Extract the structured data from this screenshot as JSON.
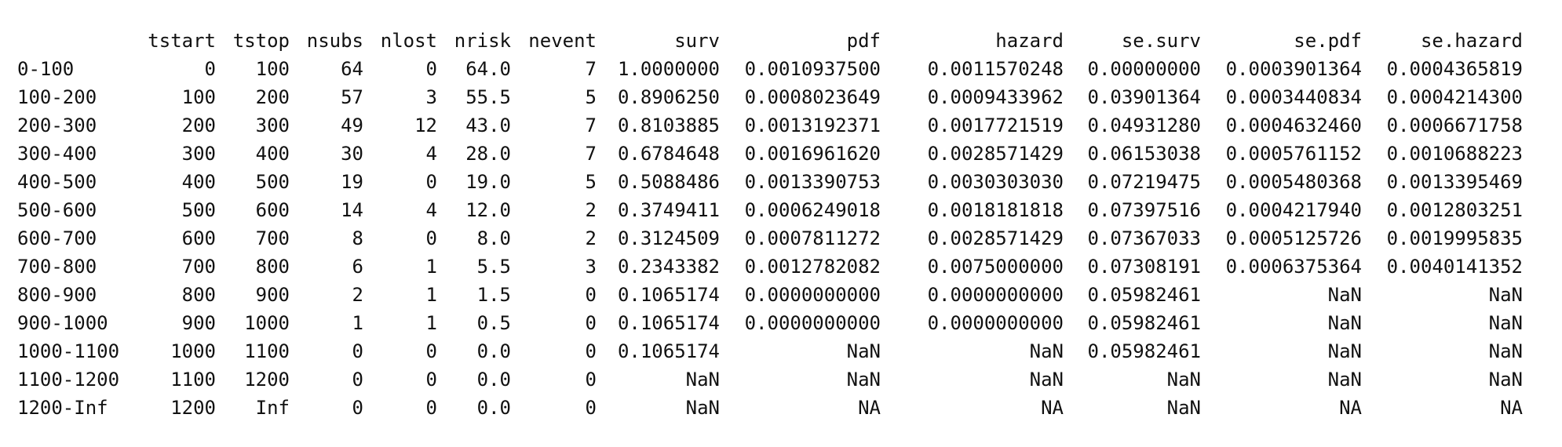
{
  "table": {
    "columns": [
      "",
      "tstart",
      "tstop",
      "nsubs",
      "nlost",
      "nrisk",
      "nevent",
      "surv",
      "pdf",
      "hazard",
      "se.surv",
      "se.pdf",
      "se.hazard"
    ],
    "rows": [
      [
        "0-100",
        "0",
        "100",
        "64",
        "0",
        "64.0",
        "7",
        "1.0000000",
        "0.0010937500",
        "0.0011570248",
        "0.00000000",
        "0.0003901364",
        "0.0004365819"
      ],
      [
        "100-200",
        "100",
        "200",
        "57",
        "3",
        "55.5",
        "5",
        "0.8906250",
        "0.0008023649",
        "0.0009433962",
        "0.03901364",
        "0.0003440834",
        "0.0004214300"
      ],
      [
        "200-300",
        "200",
        "300",
        "49",
        "12",
        "43.0",
        "7",
        "0.8103885",
        "0.0013192371",
        "0.0017721519",
        "0.04931280",
        "0.0004632460",
        "0.0006671758"
      ],
      [
        "300-400",
        "300",
        "400",
        "30",
        "4",
        "28.0",
        "7",
        "0.6784648",
        "0.0016961620",
        "0.0028571429",
        "0.06153038",
        "0.0005761152",
        "0.0010688223"
      ],
      [
        "400-500",
        "400",
        "500",
        "19",
        "0",
        "19.0",
        "5",
        "0.5088486",
        "0.0013390753",
        "0.0030303030",
        "0.07219475",
        "0.0005480368",
        "0.0013395469"
      ],
      [
        "500-600",
        "500",
        "600",
        "14",
        "4",
        "12.0",
        "2",
        "0.3749411",
        "0.0006249018",
        "0.0018181818",
        "0.07397516",
        "0.0004217940",
        "0.0012803251"
      ],
      [
        "600-700",
        "600",
        "700",
        "8",
        "0",
        "8.0",
        "2",
        "0.3124509",
        "0.0007811272",
        "0.0028571429",
        "0.07367033",
        "0.0005125726",
        "0.0019995835"
      ],
      [
        "700-800",
        "700",
        "800",
        "6",
        "1",
        "5.5",
        "3",
        "0.2343382",
        "0.0012782082",
        "0.0075000000",
        "0.07308191",
        "0.0006375364",
        "0.0040141352"
      ],
      [
        "800-900",
        "800",
        "900",
        "2",
        "1",
        "1.5",
        "0",
        "0.1065174",
        "0.0000000000",
        "0.0000000000",
        "0.05982461",
        "NaN",
        "NaN"
      ],
      [
        "900-1000",
        "900",
        "1000",
        "1",
        "1",
        "0.5",
        "0",
        "0.1065174",
        "0.0000000000",
        "0.0000000000",
        "0.05982461",
        "NaN",
        "NaN"
      ],
      [
        "1000-1100",
        "1000",
        "1100",
        "0",
        "0",
        "0.0",
        "0",
        "0.1065174",
        "NaN",
        "NaN",
        "0.05982461",
        "NaN",
        "NaN"
      ],
      [
        "1100-1200",
        "1100",
        "1200",
        "0",
        "0",
        "0.0",
        "0",
        "NaN",
        "NaN",
        "NaN",
        "NaN",
        "NaN",
        "NaN"
      ],
      [
        "1200-Inf",
        "1200",
        "Inf",
        "0",
        "0",
        "0.0",
        "0",
        "NaN",
        "NA",
        "NA",
        "NaN",
        "NA",
        "NA"
      ]
    ]
  }
}
